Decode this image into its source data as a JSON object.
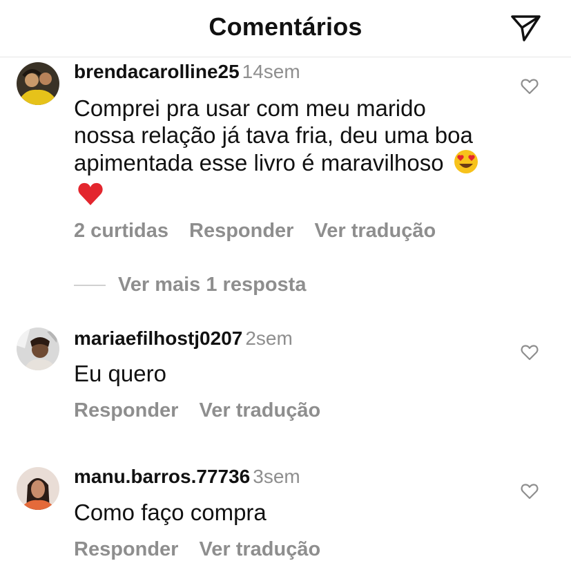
{
  "header": {
    "title": "Comentários",
    "send_icon": "paper-plane-icon"
  },
  "comments": [
    {
      "username": "brendacarolline25",
      "time": "14sem",
      "text": "Comprei pra usar com meu marido nossa relação já tava fria, deu uma boa apimentada esse livro é maravilhoso",
      "emojis": [
        "heart-eyes-emoji",
        "red-heart-emoji"
      ],
      "likes_label": "2 curtidas",
      "reply_label": "Responder",
      "translate_label": "Ver tradução",
      "view_replies_label": "Ver mais 1 resposta"
    },
    {
      "username": "mariaefilhostj0207",
      "time": "2sem",
      "text": "Eu quero",
      "reply_label": "Responder",
      "translate_label": "Ver tradução"
    },
    {
      "username": "manu.barros.77736",
      "time": "3sem",
      "text": "Como faço compra",
      "reply_label": "Responder",
      "translate_label": "Ver tradução"
    }
  ],
  "colors": {
    "text": "#111111",
    "muted": "#8e8e8e",
    "divider": "#e6e6e6",
    "heart_emoji": "#e3262e",
    "emoji_face": "#f7c21b"
  }
}
